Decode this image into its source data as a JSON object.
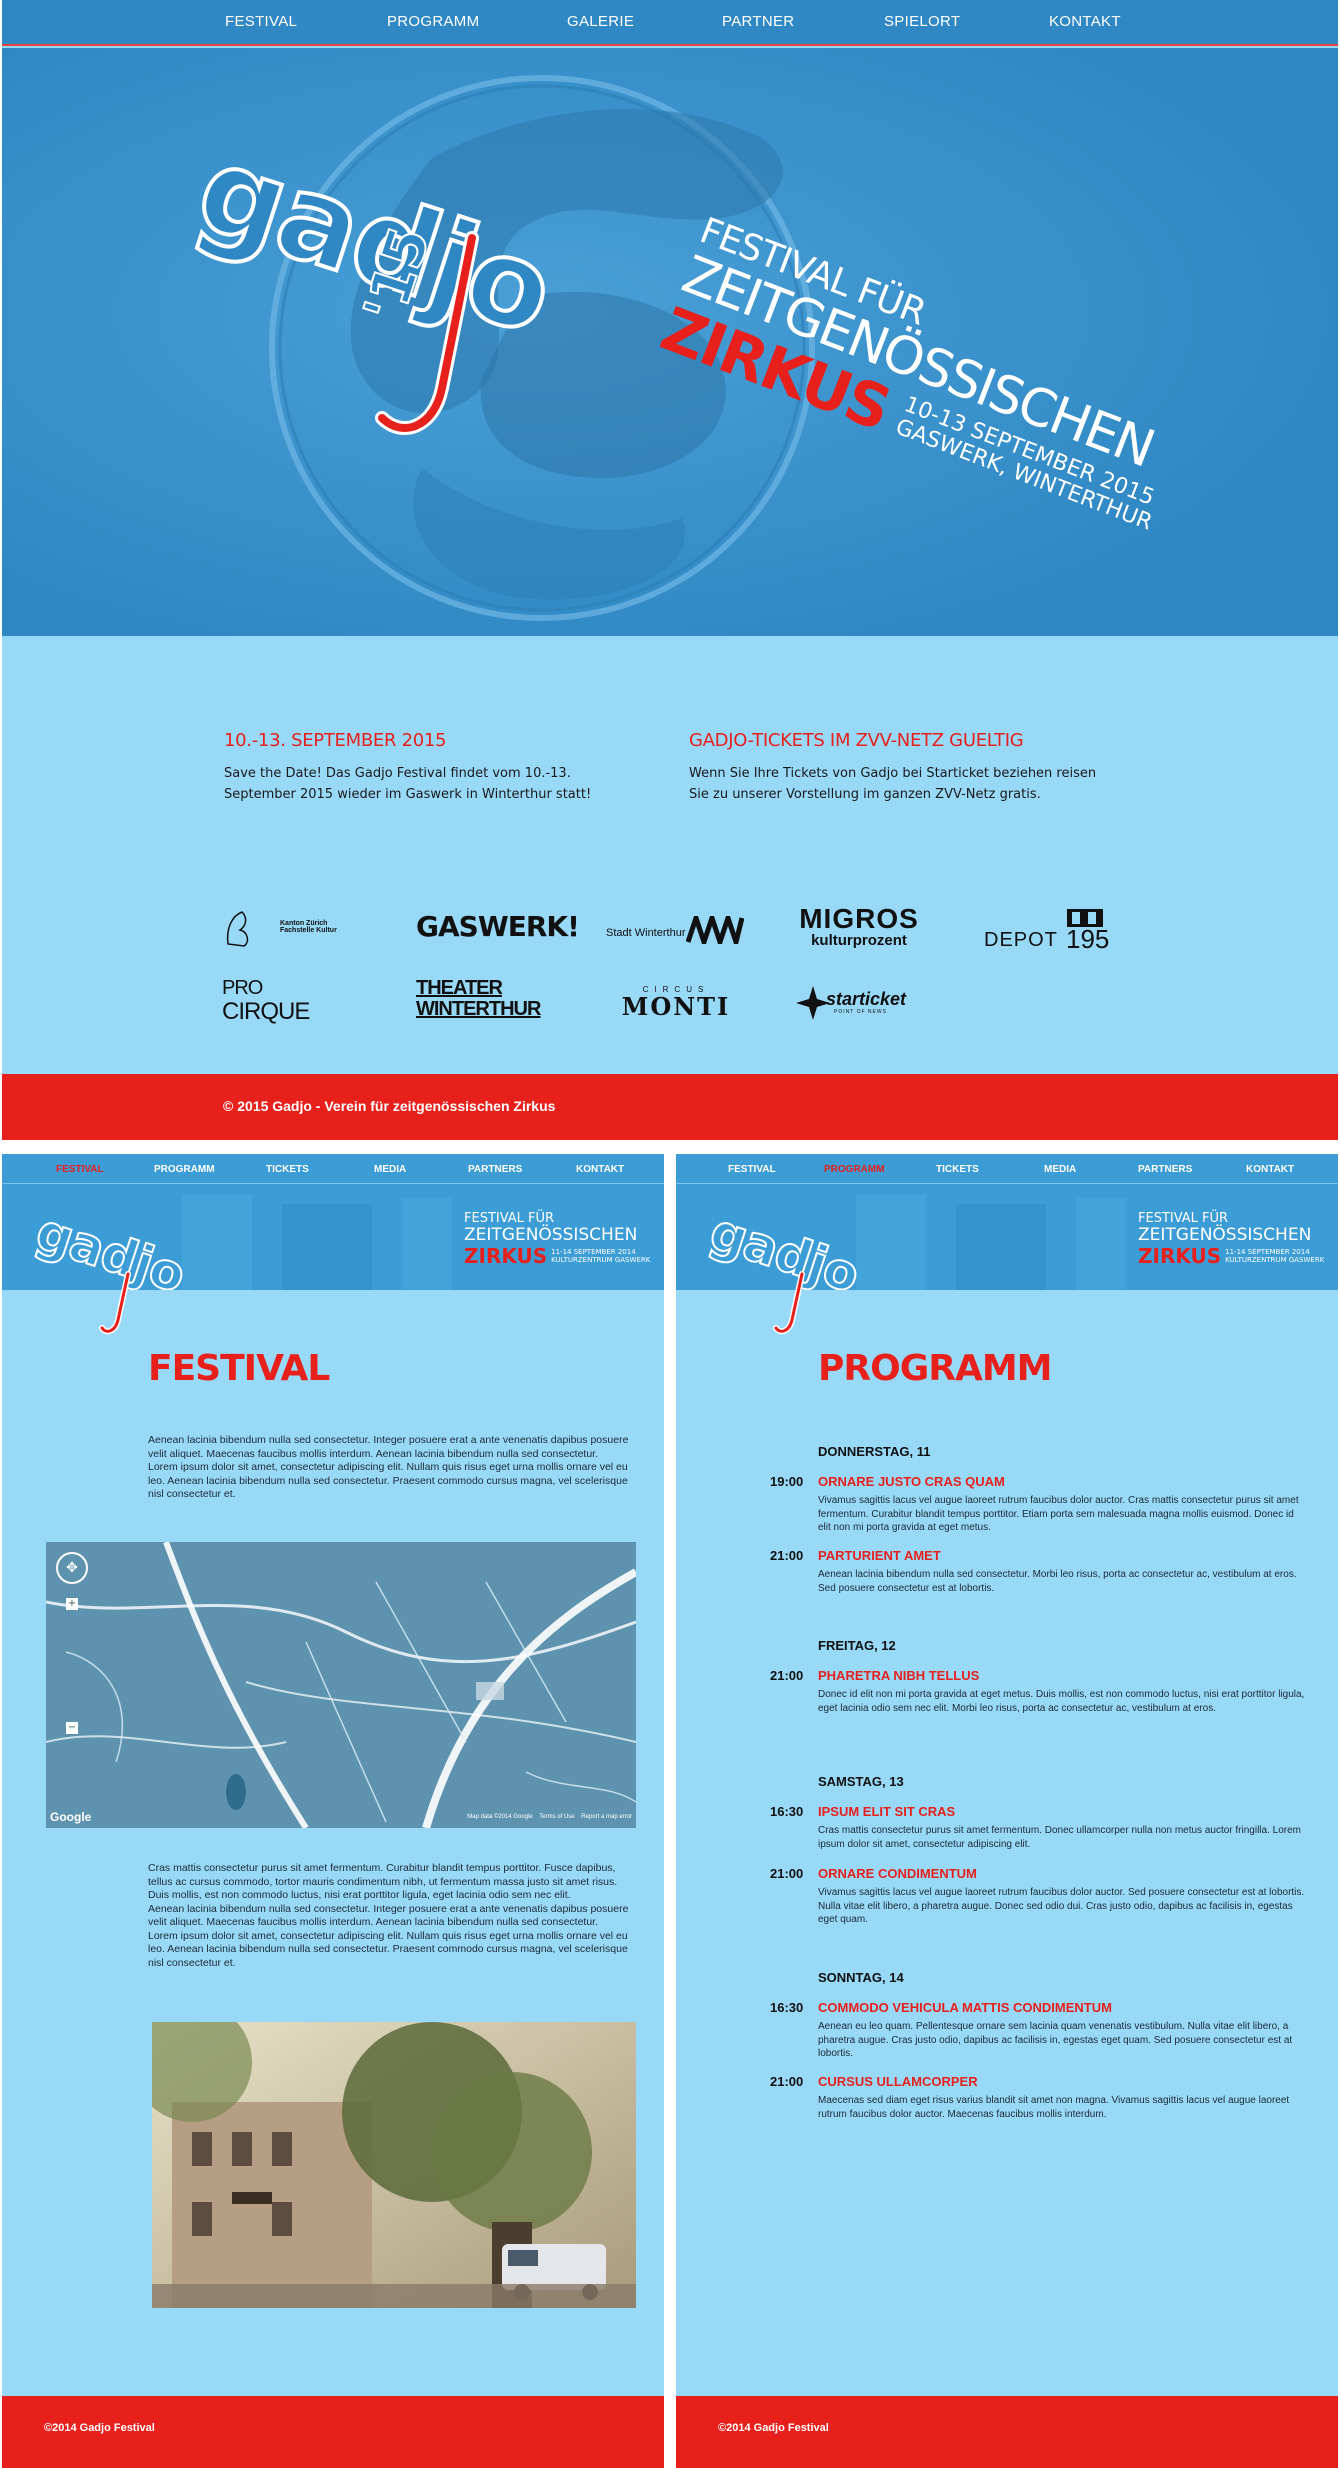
{
  "top_page": {
    "nav": [
      "FESTIVAL",
      "PROGRAMM",
      "GALERIE",
      "PARTNER",
      "SPIELORT",
      "KONTAKT"
    ],
    "logo": "gadjo",
    "logo_year": "'15",
    "slogan": {
      "line1": "FESTIVAL FÜR",
      "line2": "ZEITGENÖSSISCHEN",
      "line3": "ZIRKUS",
      "date": "10-13 SEPTEMBER 2015",
      "place": "GASWERK, WINTERTHUR"
    },
    "info_left": {
      "heading": "10.-13. SEPTEMBER 2015",
      "text": "Save the Date! Das Gadjo Festival findet vom 10.-13. September 2015 wieder im Gaswerk in Winterthur statt!"
    },
    "info_right": {
      "heading": "GADJO-TICKETS IM ZVV-NETZ GUELTIG",
      "text": "Wenn Sie Ihre Tickets von Gadjo bei Starticket beziehen reisen Sie zu unserer Vorstellung im ganzen ZVV-Netz gratis."
    },
    "sponsors": {
      "kanton": "Kanton Zürich\nFachstelle Kultur",
      "gaswerk": "GASWERK!",
      "winterthur": "Stadt Winterthur",
      "migros1": "MIGROS",
      "migros2": "kulturprozent",
      "depot1": "DEPOT",
      "depot2": "195",
      "procirque1": "PRO",
      "procirque2": "CIRQUE",
      "theater1": "THEATER",
      "theater2": "WINTERTHUR",
      "circus": "CIRCUS",
      "monti": "MONTI",
      "starticket": "starticket",
      "starticket_sub": "POINT OF NEWS"
    },
    "footer": "© 2015 Gadjo - Verein für zeitgenössischen Zirkus"
  },
  "festival_page": {
    "nav": [
      "FESTIVAL",
      "PROGRAMM",
      "TICKETS",
      "MEDIA",
      "PARTNERS",
      "KONTAKT"
    ],
    "active_nav": "FESTIVAL",
    "logo": "gadjo",
    "slogan": {
      "line1": "FESTIVAL FÜR",
      "line2": "ZEITGENÖSSISCHEN",
      "line3": "ZIRKUS",
      "date": "11-14 SEPTEMBER 2014",
      "place": "KULTURZENTRUM GASWERK"
    },
    "title": "FESTIVAL",
    "para1": "Aenean lacinia bibendum nulla sed consectetur. Integer posuere erat a ante venenatis dapibus posuere velit aliquet. Maecenas faucibus mollis interdum. Aenean lacinia bibendum nulla sed consectetur.\nLorem ipsum dolor sit amet, consectetur adipiscing elit. Nullam quis risus eget urna mollis ornare vel eu leo. Aenean lacinia bibendum nulla sed consectetur. Praesent commodo cursus magna, vel scelerisque nisl consectetur et.",
    "map_label": "Google",
    "map_attr": "Map data ©2014 Google    Terms of Use    Report a map error",
    "para2": "Cras mattis consectetur purus sit amet fermentum. Curabitur blandit tempus porttitor. Fusce dapibus, tellus ac cursus commodo, tortor mauris condimentum nibh, ut fermentum massa justo sit amet risus. Duis mollis, est non commodo luctus, nisi erat porttitor ligula, eget lacinia odio sem nec elit.\nAenean lacinia bibendum nulla sed consectetur. Integer posuere erat a ante venenatis dapibus posuere velit aliquet. Maecenas faucibus mollis interdum. Aenean lacinia bibendum nulla sed consectetur.\nLorem ipsum dolor sit amet, consectetur adipiscing elit. Nullam quis risus eget urna mollis ornare vel eu leo. Aenean lacinia bibendum nulla sed consectetur. Praesent commodo cursus magna, vel scelerisque nisl consectetur et.",
    "footer": "©2014 Gadjo Festival"
  },
  "programm_page": {
    "nav": [
      "FESTIVAL",
      "PROGRAMM",
      "TICKETS",
      "MEDIA",
      "PARTNERS",
      "KONTAKT"
    ],
    "active_nav": "PROGRAMM",
    "logo": "gadjo",
    "slogan": {
      "line1": "FESTIVAL FÜR",
      "line2": "ZEITGENÖSSISCHEN",
      "line3": "ZIRKUS",
      "date": "11-14 SEPTEMBER 2014",
      "place": "KULTURZENTRUM GASWERK"
    },
    "title": "PROGRAMM",
    "days": [
      {
        "day": "DONNERSTAG, 11",
        "events": [
          {
            "time": "19:00",
            "title": "ORNARE JUSTO CRAS QUAM",
            "desc": "Vivamus sagittis lacus vel augue laoreet rutrum faucibus dolor auctor. Cras mattis consectetur purus sit amet fermentum. Curabitur blandit tempus porttitor. Etiam porta sem malesuada magna mollis euismod. Donec id elit non mi porta gravida at eget metus."
          },
          {
            "time": "21:00",
            "title": "PARTURIENT AMET",
            "desc": "Aenean lacinia bibendum nulla sed consectetur. Morbi leo risus, porta ac consectetur ac, vestibulum at eros. Sed posuere consectetur est at lobortis."
          }
        ]
      },
      {
        "day": "FREITAG, 12",
        "events": [
          {
            "time": "21:00",
            "title": "PHARETRA NIBH TELLUS",
            "desc": "Donec id elit non mi porta gravida at eget metus. Duis mollis, est non commodo luctus, nisi erat porttitor ligula, eget lacinia odio sem nec elit. Morbi leo risus, porta ac consectetur ac, vestibulum at eros."
          }
        ]
      },
      {
        "day": "SAMSTAG, 13",
        "events": [
          {
            "time": "16:30",
            "title": "IPSUM ELIT SIT CRAS",
            "desc": "Cras mattis consectetur purus sit amet fermentum. Donec ullamcorper nulla non metus auctor fringilla. Lorem ipsum dolor sit amet, consectetur adipiscing elit."
          },
          {
            "time": "21:00",
            "title": "ORNARE CONDIMENTUM",
            "desc": "Vivamus sagittis lacus vel augue laoreet rutrum faucibus dolor auctor. Sed posuere consectetur est at lobortis. Nulla vitae elit libero, a pharetra augue. Donec sed odio dui. Cras justo odio, dapibus ac facilisis in, egestas eget quam."
          }
        ]
      },
      {
        "day": "SONNTAG, 14",
        "events": [
          {
            "time": "16:30",
            "title": "COMMODO VEHICULA MATTIS CONDIMENTUM",
            "desc": "Aenean eu leo quam. Pellentesque ornare sem lacinia quam venenatis vestibulum. Nulla vitae elit libero, a pharetra augue. Cras justo odio, dapibus ac facilisis in, egestas eget quam. Sed posuere consectetur est at lobortis."
          },
          {
            "time": "21:00",
            "title": "CURSUS ULLAMCORPER",
            "desc": "Maecenas sed diam eget risus varius blandit sit amet non magna. Vivamus sagittis lacus vel augue laoreet rutrum faucibus dolor auctor. Maecenas faucibus mollis interdum."
          }
        ]
      }
    ],
    "footer": "©2014 Gadjo Festival"
  },
  "colors": {
    "blue": "#2f88c4",
    "light_blue": "#98d9f7",
    "red": "#e8201c"
  }
}
